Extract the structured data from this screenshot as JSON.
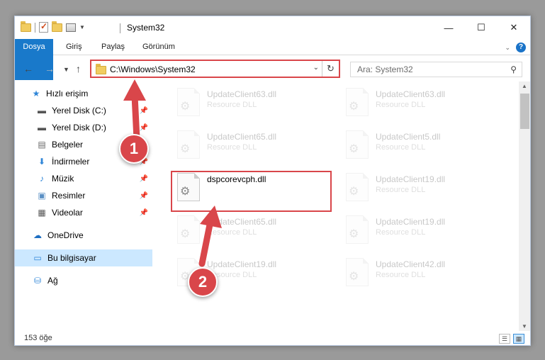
{
  "window": {
    "title": "System32",
    "minimize": "—",
    "maximize": "☐",
    "close": "✕"
  },
  "ribbon": {
    "tabs": [
      "Dosya",
      "Giriş",
      "Paylaş",
      "Görünüm"
    ],
    "help": "?"
  },
  "address": {
    "path": "C:\\Windows\\System32",
    "search_placeholder": "Ara: System32"
  },
  "nav": {
    "items": [
      {
        "label": "Hızlı erişim",
        "icon": "star-icon"
      },
      {
        "label": "Yerel Disk (C:)",
        "icon": "drive-icon",
        "pinned": true
      },
      {
        "label": "Yerel Disk (D:)",
        "icon": "drive-icon",
        "pinned": true
      },
      {
        "label": "Belgeler",
        "icon": "documents-icon",
        "pinned": true
      },
      {
        "label": "İndirmeler",
        "icon": "download-icon",
        "pinned": true
      },
      {
        "label": "Müzik",
        "icon": "music-icon",
        "pinned": true
      },
      {
        "label": "Resimler",
        "icon": "pictures-icon",
        "pinned": true
      },
      {
        "label": "Videolar",
        "icon": "videos-icon",
        "pinned": true
      },
      {
        "label": "OneDrive",
        "icon": "cloud-icon"
      },
      {
        "label": "Bu bilgisayar",
        "icon": "computer-icon",
        "selected": true
      },
      {
        "label": "Ağ",
        "icon": "network-icon"
      }
    ]
  },
  "files": [
    {
      "name": "UpdateClient63.dll",
      "type": "Resource DLL"
    },
    {
      "name": "UpdateClient63.dll",
      "type": "Resource DLL"
    },
    {
      "name": "UpdateClient65.dll",
      "type": "Resource DLL"
    },
    {
      "name": "UpdateClient5.dll",
      "type": "Resource DLL"
    },
    {
      "name": "dspcorevcph.dll",
      "type": ""
    },
    {
      "name": "UpdateClient19.dll",
      "type": "Resource DLL"
    },
    {
      "name": "UpdateClient65.dll",
      "type": "Resource DLL"
    },
    {
      "name": "UpdateClient19.dll",
      "type": "Resource DLL"
    },
    {
      "name": "UpdateClient19.dll",
      "type": "Resource DLL"
    },
    {
      "name": "UpdateClient42.dll",
      "type": "Resource DLL"
    }
  ],
  "status": {
    "count": "153 öğe"
  },
  "annotations": {
    "badge1": "1",
    "badge2": "2",
    "highlight_color": "#d9464a"
  }
}
